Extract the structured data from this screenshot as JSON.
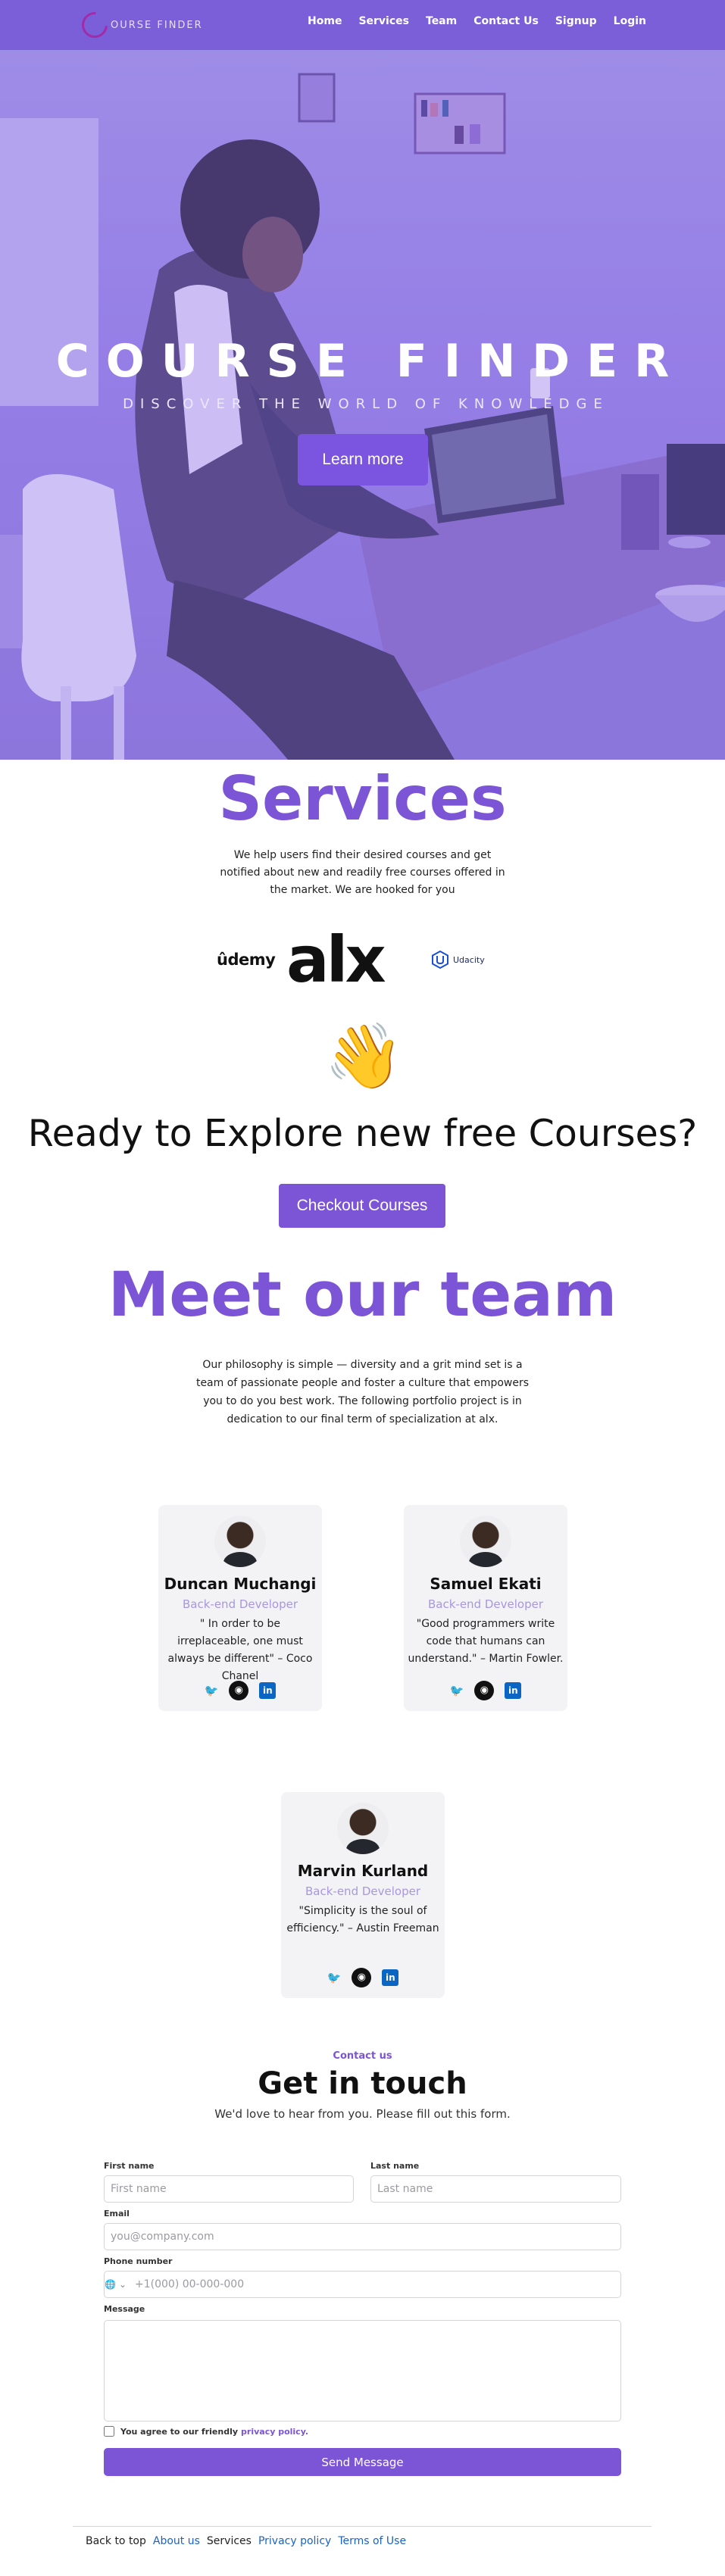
{
  "nav": {
    "logo_text": "OURSE FINDER",
    "links": [
      "Home",
      "Services",
      "Team",
      "Contact Us",
      "Signup",
      "Login"
    ]
  },
  "hero": {
    "title": "COURSE FINDER",
    "subtitle": "DISCOVER THE WORLD OF KNOWLEDGE",
    "button": "Learn more"
  },
  "services": {
    "title": "Services",
    "description": "We help users find their desired courses and get notified about new and readily free courses offered in the market. We are hooked for you",
    "partners": {
      "udemy": "ûdemy",
      "alx": "alx",
      "udacity": "Udacity"
    },
    "explore_title": "Ready to Explore new free Courses?",
    "checkout_button": "Checkout Courses"
  },
  "team": {
    "title": "Meet our team",
    "description": "Our philosophy is simple — diversity and a grit mind set is a team of passionate people and foster a culture that empowers you to do you best work. The following portfolio project is in dedication to our final term of specialization at alx.",
    "members": [
      {
        "name": "Duncan Muchangi",
        "role": "Back-end Developer",
        "quote": "\" In order to be irreplaceable, one must always be different\" – Coco Chanel"
      },
      {
        "name": "Samuel Ekati",
        "role": "Back-end Developer",
        "quote": "\"Good programmers write code that humans can understand.\" – Martin Fowler."
      },
      {
        "name": "Marvin Kurland",
        "role": "Back-end Developer",
        "quote": "\"Simplicity is the soul of efficiency.\" – Austin Freeman"
      }
    ]
  },
  "contact": {
    "kicker": "Contact us",
    "title": "Get in touch",
    "subtitle": "We'd love to hear from you. Please fill out this form.",
    "first_name_label": "First name",
    "first_name_placeholder": "First name",
    "last_name_label": "Last name",
    "last_name_placeholder": "Last name",
    "email_label": "Email",
    "email_placeholder": "you@company.com",
    "phone_label": "Phone number",
    "phone_placeholder": "+1(000) 00-000-000",
    "message_label": "Message",
    "agree_text": "You agree to our friendly",
    "privacy_link": "privacy policy.",
    "send_button": "Send Message"
  },
  "footer": {
    "back_to_top": "Back to top",
    "about": "About us",
    "services": "Services",
    "privacy": "Privacy policy",
    "terms": "Terms of Use"
  },
  "colors": {
    "accent": "#7b55d6",
    "nav": "#7b5fd8",
    "role_text": "#a897e0"
  }
}
